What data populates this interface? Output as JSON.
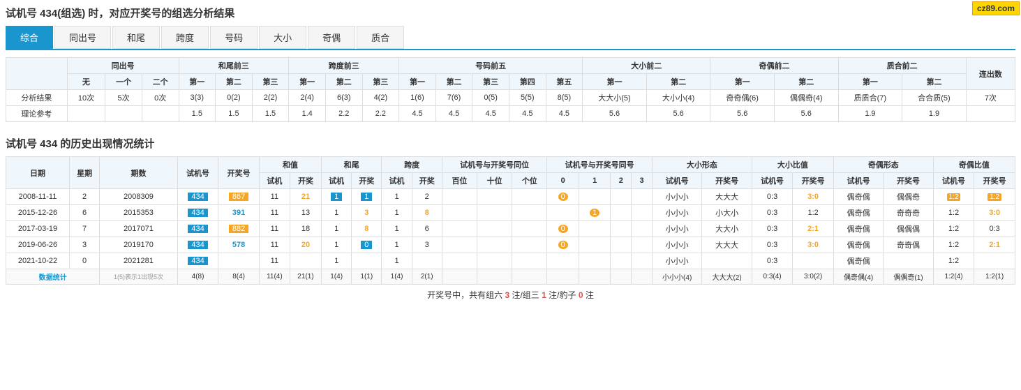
{
  "site_badge": "cz89.com",
  "page_title": "试机号 434(组选) 时，对应开奖号的组选分析结果",
  "tabs": [
    {
      "label": "综合",
      "active": true
    },
    {
      "label": "同出号",
      "active": false
    },
    {
      "label": "和尾",
      "active": false
    },
    {
      "label": "跨度",
      "active": false
    },
    {
      "label": "号码",
      "active": false
    },
    {
      "label": "大小",
      "active": false
    },
    {
      "label": "奇偶",
      "active": false
    },
    {
      "label": "质合",
      "active": false
    }
  ],
  "analysis": {
    "headers": {
      "groups": [
        "同出号",
        "和尾前三",
        "跨度前三",
        "号码前五",
        "大小前二",
        "奇偶前二",
        "质合前二",
        "连出数"
      ]
    },
    "sub_headers": {
      "tonchu": [
        "无",
        "一个",
        "二个"
      ],
      "hewei": [
        "第一",
        "第二",
        "第三"
      ],
      "kuadu": [
        "第一",
        "第二",
        "第三"
      ],
      "haoma": [
        "第一",
        "第二",
        "第三",
        "第四",
        "第五"
      ],
      "daxiao": [
        "第一",
        "第二"
      ],
      "jiouu": [
        "第一",
        "第二"
      ],
      "zhihe": [
        "第一",
        "第二"
      ]
    },
    "rows": {
      "result": {
        "label": "分析结果",
        "tonchu": [
          "10次",
          "5次",
          "0次"
        ],
        "hewei": [
          "3(3)",
          "0(2)",
          "2(2)"
        ],
        "kuadu": [
          "2(4)",
          "6(3)",
          "4(2)"
        ],
        "haoma": [
          "1(6)",
          "7(6)",
          "0(5)",
          "5(5)",
          "8(5)"
        ],
        "daxiao": [
          "大大小(5)",
          "大小小(4)"
        ],
        "jiouu": [
          "奇奇偶(6)",
          "偶偶奇(4)"
        ],
        "zhihe": [
          "质质合(7)",
          "合合质(5)"
        ],
        "lianchu": "7次"
      },
      "theory": {
        "label": "理论参考",
        "hewei": [
          "1.5",
          "1.5",
          "1.5"
        ],
        "kuadu": [
          "1.4",
          "2.2",
          "2.2"
        ],
        "haoma": [
          "4.5",
          "4.5",
          "4.5",
          "4.5",
          "4.5"
        ],
        "daxiao": [
          "5.6",
          "5.6"
        ],
        "jiouu": [
          "5.6",
          "5.6"
        ],
        "zhihe": [
          "1.9",
          "1.9"
        ]
      }
    }
  },
  "history": {
    "title": "试机号 434 的历史出现情况统计",
    "col_headers": {
      "main": [
        "日期",
        "星期",
        "期数",
        "试机号",
        "开奖号",
        "和值",
        "和尾",
        "跨度",
        "试机号与开奖号同位",
        "试机号与开奖号同号",
        "大小形态",
        "大小比值",
        "奇偶形态",
        "奇偶比值"
      ],
      "heZhi": [
        "试机",
        "开奖"
      ],
      "heWei": [
        "试机",
        "开奖"
      ],
      "kuaDu": [
        "试机",
        "开奖"
      ],
      "tongWei": [
        "百位",
        "十位",
        "个位"
      ],
      "tongHao": [
        "0",
        "1",
        "2",
        "3"
      ],
      "daxiaoXingtai": [
        "试机号",
        "开奖号"
      ],
      "daxiaoBizhi": [
        "试机号",
        "开奖号"
      ],
      "jiouu_xingtai": [
        "试机号",
        "开奖号"
      ],
      "jiouu_bizhi": [
        "试机号",
        "开奖号"
      ]
    },
    "rows": [
      {
        "date": "2008-11-11",
        "weekday": "2",
        "period": "2008309",
        "shiji": "434",
        "kaijang": "867",
        "heZhi_shiji": "11",
        "heZhi_kaijang": "21",
        "heWei_shiji": "1",
        "heWei_kaijang": "1",
        "kuaDu_shiji": "1",
        "kuaDu_kaijang": "2",
        "tongWei": [
          "",
          "",
          ""
        ],
        "tongHao": [
          "0",
          "",
          "",
          ""
        ],
        "daxiao_shiji": "小小小",
        "daxiao_kaijang": "大大大",
        "daxiao_bz_shiji": "0:3",
        "daxiao_bz_kaijang": "3:0",
        "jiouu_shiji": "偶奇偶",
        "jiouu_kaijang": "偶偶奇",
        "jiouu_bz_shiji": "1:2",
        "jiouu_bz_kaijang": "1:2",
        "special_kaijang_color": "orange",
        "special_heWei_shiji": "blue",
        "special_heWei_kaijang": "blue",
        "special_tongHao_0": "orange",
        "special_daxiao_bz_kaijang": "orange",
        "special_jiouu_bz_shiji": "orange",
        "special_jiouu_bz_kaijang": "orange"
      },
      {
        "date": "2015-12-26",
        "weekday": "6",
        "period": "2015353",
        "shiji": "434",
        "kaijang": "391",
        "heZhi_shiji": "11",
        "heZhi_kaijang": "13",
        "heWei_shiji": "1",
        "heWei_kaijang": "3",
        "kuaDu_shiji": "1",
        "kuaDu_kaijang": "8",
        "tongWei": [
          "",
          "",
          ""
        ],
        "tongHao": [
          "",
          "1",
          "",
          ""
        ],
        "daxiao_shiji": "小小小",
        "daxiao_kaijang": "小大小",
        "daxiao_bz_shiji": "0:3",
        "daxiao_bz_kaijang": "1:2",
        "jiouu_shiji": "偶奇偶",
        "jiouu_kaijang": "奇奇奇",
        "jiouu_bz_shiji": "1:2",
        "jiouu_bz_kaijang": "3:0",
        "special_heWei_kaijang": "orange",
        "special_tongHao_1": "orange",
        "special_daxiao_bz_kaijang": ""
      },
      {
        "date": "2017-03-19",
        "weekday": "7",
        "period": "2017071",
        "shiji": "434",
        "kaijang": "882",
        "heZhi_shiji": "11",
        "heZhi_kaijang": "18",
        "heWei_shiji": "1",
        "heWei_kaijang": "8",
        "kuaDu_shiji": "1",
        "kuaDu_kaijang": "6",
        "tongWei": [
          "",
          "",
          ""
        ],
        "tongHao": [
          "0",
          "",
          "",
          ""
        ],
        "daxiao_shiji": "小小小",
        "daxiao_kaijang": "大大小",
        "daxiao_bz_shiji": "0:3",
        "daxiao_bz_kaijang": "2:1",
        "jiouu_shiji": "偶奇偶",
        "jiouu_kaijang": "偶偶偶",
        "jiouu_bz_shiji": "1:2",
        "jiouu_bz_kaijang": "0:3",
        "special_kaijang_color": "orange",
        "special_heWei_kaijang": "orange",
        "special_tongHao_0": "orange",
        "special_daxiao_bz_kaijang": "orange"
      },
      {
        "date": "2019-06-26",
        "weekday": "3",
        "period": "2019170",
        "shiji": "434",
        "kaijang": "578",
        "heZhi_shiji": "11",
        "heZhi_kaijang": "20",
        "heWei_shiji": "1",
        "heWei_kaijang": "0",
        "kuaDu_shiji": "1",
        "kuaDu_kaijang": "3",
        "tongWei": [
          "",
          "",
          ""
        ],
        "tongHao": [
          "0",
          "",
          "",
          ""
        ],
        "daxiao_shiji": "小小小",
        "daxiao_kaijang": "大大大",
        "daxiao_bz_shiji": "0:3",
        "daxiao_bz_kaijang": "3:0",
        "jiouu_shiji": "偶奇偶",
        "jiouu_kaijang": "奇奇偶",
        "jiouu_bz_shiji": "1:2",
        "jiouu_bz_kaijang": "2:1",
        "special_heWei_kaijang": "blue",
        "special_tongHao_0": "orange",
        "special_daxiao_bz_kaijang": "orange",
        "special_jiouu_bz_kaijang": "orange"
      },
      {
        "date": "2021-10-22",
        "weekday": "0",
        "period": "2021281",
        "shiji": "434",
        "kaijang": "",
        "heZhi_shiji": "11",
        "heZhi_kaijang": "",
        "heWei_shiji": "1",
        "heWei_kaijang": "",
        "kuaDu_shiji": "1",
        "kuaDu_kaijang": "",
        "tongWei": [
          "",
          "",
          ""
        ],
        "tongHao": [
          "",
          "",
          "",
          ""
        ],
        "daxiao_shiji": "小小小",
        "daxiao_kaijang": "",
        "daxiao_bz_shiji": "0:3",
        "daxiao_bz_kaijang": "",
        "jiouu_shiji": "偶奇偶",
        "jiouu_kaijang": "",
        "jiouu_bz_shiji": "1:2",
        "jiouu_bz_kaijang": ""
      }
    ],
    "summary_row": {
      "label": "数据统计",
      "note": "1(5)表示1出现5次",
      "shiji": "4(8)",
      "kaijang": "8(4)",
      "heZhi_shiji": "11(4)",
      "heZhi_kaijang": "21(1)",
      "heWei_shiji": "1(4)",
      "heWei_kaijang": "1(1)",
      "kuaDu_shiji": "1(4)",
      "kuaDu_kaijang": "2(1)",
      "daxiao_shiji": "小小小(4)",
      "daxiao_kaijang": "大大大(2)",
      "daxiao_bz_shiji": "0:3(4)",
      "daxiao_bz_kaijang": "3:0(2)",
      "jiouu_shiji": "偶奇偶(4)",
      "jiouu_kaijang": "偶偶奇(1)",
      "jiouu_bz_shiji": "1:2(4)",
      "jiouu_bz_kaijang": "1:2(1)"
    },
    "footer": "开奖号中，共有组六 3 注/组三 1 注/豹子 0 注"
  }
}
